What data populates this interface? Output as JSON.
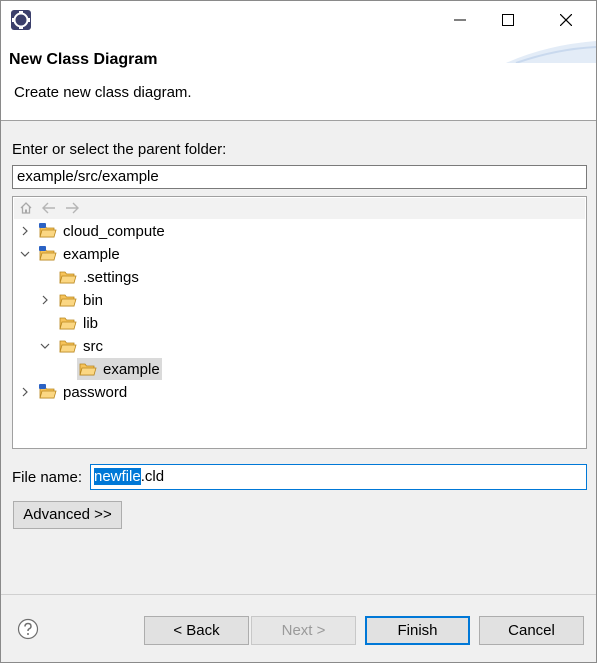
{
  "window": {
    "app_icon": "eclipse-icon",
    "controls": [
      "minimize-icon",
      "maximize-icon",
      "close-icon"
    ]
  },
  "banner": {
    "title": "New Class Diagram",
    "description": "Create new class diagram."
  },
  "parent_folder": {
    "label": "Enter or select the parent folder:",
    "value": "example/src/example"
  },
  "tree": {
    "toolbar_icons": [
      "home-icon",
      "back-arrow-icon",
      "forward-arrow-icon"
    ],
    "items": [
      {
        "label": "cloud_compute",
        "expanded": false
      },
      {
        "label": "example",
        "expanded": true
      },
      {
        "label": ".settings"
      },
      {
        "label": "bin",
        "expanded": false
      },
      {
        "label": "lib"
      },
      {
        "label": "src",
        "expanded": true
      },
      {
        "label": "example",
        "selected": true
      },
      {
        "label": "password",
        "expanded": false
      }
    ]
  },
  "file_name": {
    "label": "File name:",
    "selected_part": "newfile",
    "rest": ".cld"
  },
  "advanced_button": "Advanced >>",
  "buttons": {
    "back": "< Back",
    "next": "Next >",
    "finish": "Finish",
    "cancel": "Cancel"
  },
  "colors": {
    "accent": "#0078d7",
    "folder": "#e8a935"
  }
}
